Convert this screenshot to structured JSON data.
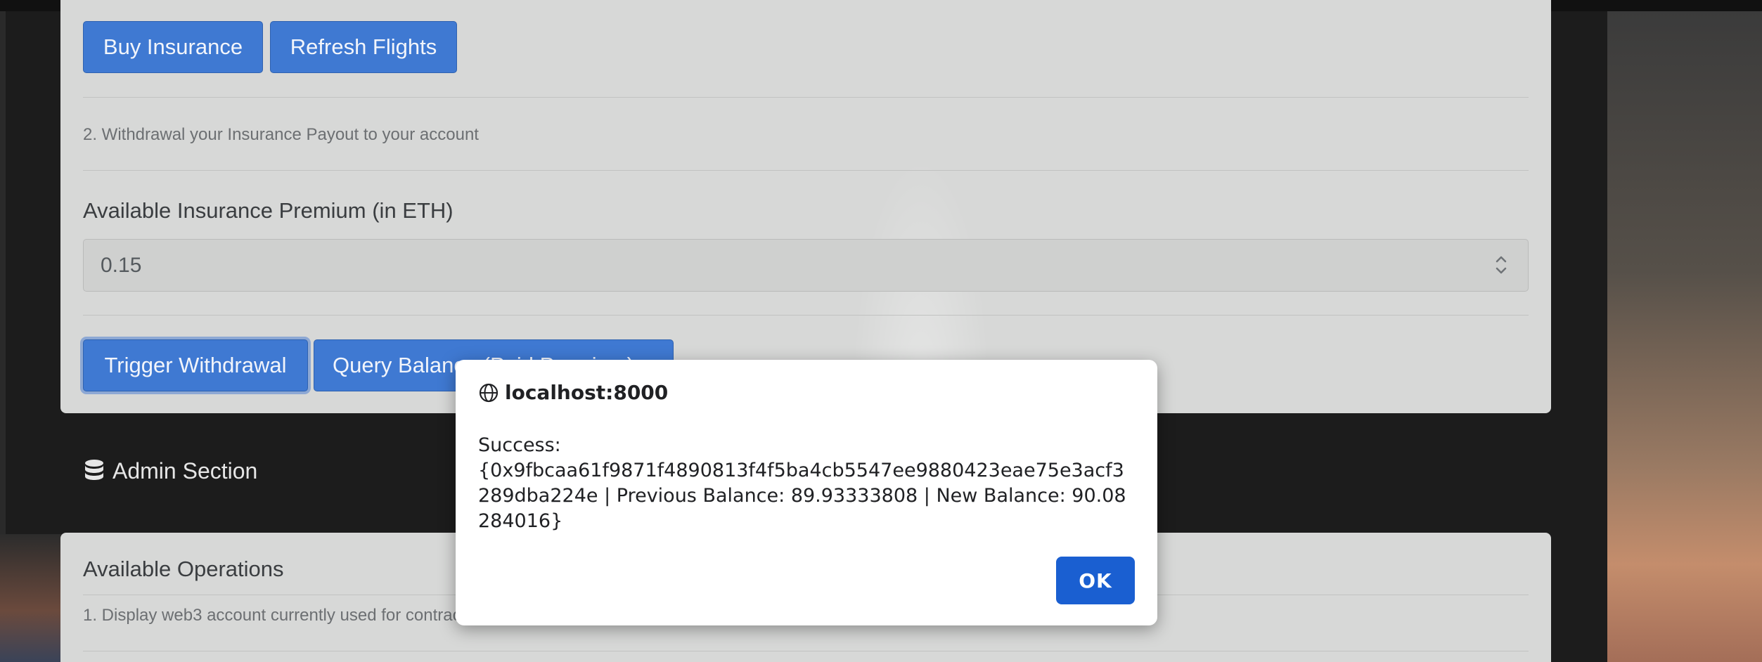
{
  "insurance": {
    "buy_label": "Buy Insurance",
    "refresh_label": "Refresh Flights",
    "step2_text": "2. Withdrawal your Insurance Payout to your account",
    "premium_label": "Available Insurance Premium (in ETH)",
    "premium_value": "0.15",
    "trigger_label": "Trigger Withdrawal",
    "query_label": "Query Balance (Paid Premium)"
  },
  "admin": {
    "heading": "Admin Section",
    "icon": "database-icon",
    "operations_title": "Available Operations",
    "step1_text": "1. Display web3 account currently used for contract interaction"
  },
  "dialog": {
    "origin": "localhost:8000",
    "message": "Success:\n{0x9fbcaa61f9871f4890813f4f5ba4cb5547ee9880423eae75e3acf3289dba224e | Previous Balance: 89.93333808 | New Balance: 90.08284016}",
    "ok_label": "OK"
  },
  "colors": {
    "button_primary": "#3f79d2",
    "dialog_ok": "#1a5fd1"
  }
}
